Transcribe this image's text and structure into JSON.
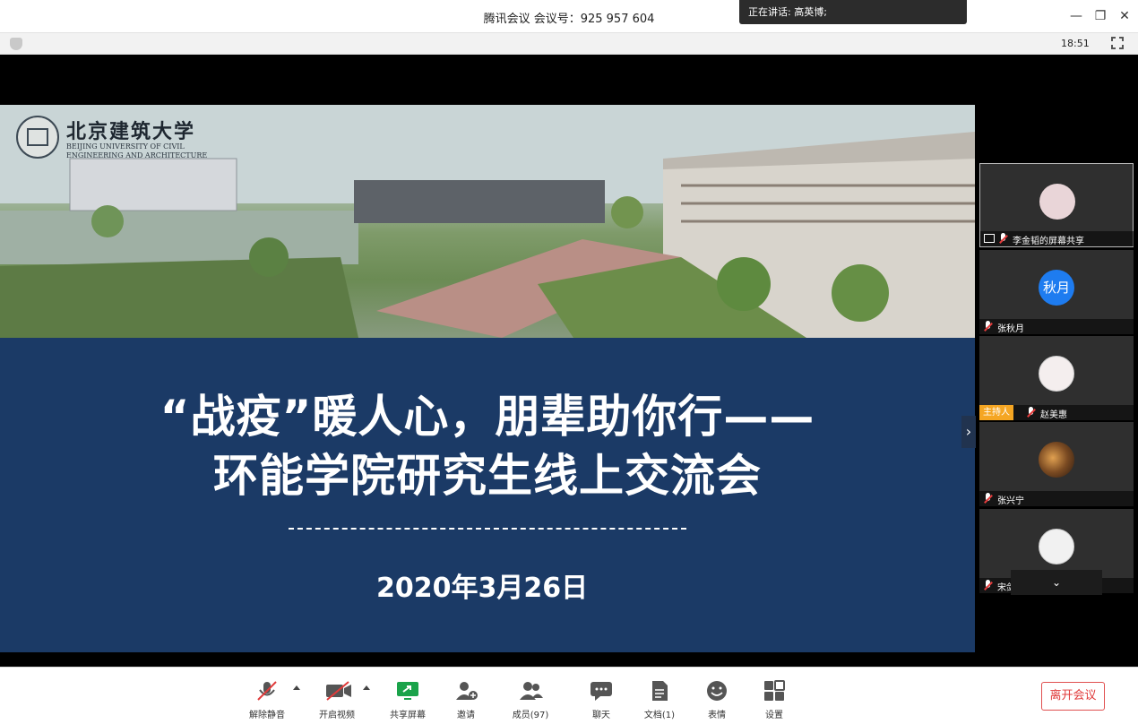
{
  "window": {
    "title": "腾讯会议 会议号：925 957 604",
    "speaking": "正在讲话: 高英博;",
    "time": "18:51"
  },
  "slide": {
    "university_cn": "北京建筑大学",
    "university_en": "BEIJING UNIVERSITY OF CIVIL ENGINEERING AND ARCHITECTURE",
    "title_line1": "“战疫”暖人心，朋辈助你行——",
    "title_line2": "环能学院研究生线上交流会",
    "date": "2020年3月26日"
  },
  "participants": [
    {
      "name": "李金韬的屏幕共享",
      "avatar": "rabbit-avatar",
      "sharing": true
    },
    {
      "name": "张秋月",
      "avatar_text": "秋月",
      "avatar_color": "#1e7cf0"
    },
    {
      "name": "赵美惠",
      "avatar": "pig-avatar",
      "host_badge": "主持人"
    },
    {
      "name": "张兴宁",
      "avatar": "photo-avatar"
    },
    {
      "name": "宋剑英",
      "avatar": "anime-avatar"
    }
  ],
  "toolbar": {
    "mute": "解除静音",
    "video": "开启视频",
    "share": "共享屏幕",
    "invite": "邀请",
    "members": "成员(97)",
    "chat": "聊天",
    "docs": "文档(1)",
    "emoji": "表情",
    "settings": "设置",
    "leave": "离开会议"
  },
  "colors": {
    "slide_bg": "#1b3a66",
    "share_green": "#1aa34a",
    "leave_red": "#e03a3a",
    "host_orange": "#f5a623"
  }
}
